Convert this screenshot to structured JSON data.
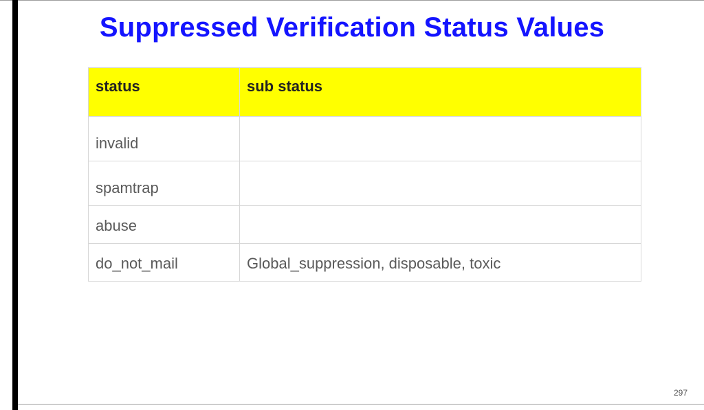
{
  "title": "Suppressed Verification Status Values",
  "columns": {
    "c1": "status",
    "c2": "sub status"
  },
  "rows": [
    {
      "status": "invalid",
      "sub": ""
    },
    {
      "status": "spamtrap",
      "sub": ""
    },
    {
      "status": "abuse",
      "sub": ""
    },
    {
      "status": "do_not_mail",
      "sub": "Global_suppression, disposable, toxic"
    }
  ],
  "page_number": "297",
  "colors": {
    "title": "#1414ff",
    "header_bg": "#ffff00",
    "cell_text": "#5a5a5a",
    "border": "#d7d7d7"
  },
  "chart_data": {
    "type": "table",
    "title": "Suppressed Verification Status Values",
    "columns": [
      "status",
      "sub status"
    ],
    "rows": [
      [
        "invalid",
        ""
      ],
      [
        "spamtrap",
        ""
      ],
      [
        "abuse",
        ""
      ],
      [
        "do_not_mail",
        "Global_suppression, disposable, toxic"
      ]
    ]
  }
}
